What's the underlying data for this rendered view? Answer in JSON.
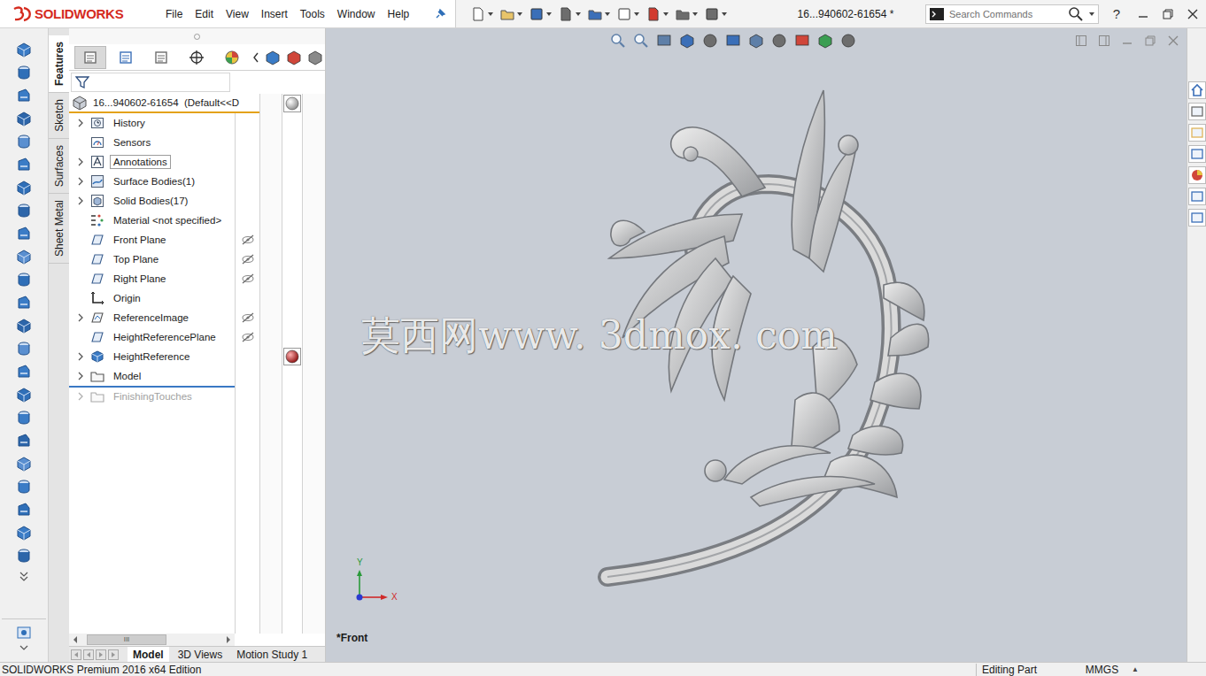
{
  "app": {
    "brand": "SOLIDWORKS"
  },
  "menu": [
    "File",
    "Edit",
    "View",
    "Insert",
    "Tools",
    "Window",
    "Help"
  ],
  "document": {
    "title": "16...940602-61654 *"
  },
  "search": {
    "placeholder": "Search Commands"
  },
  "help": {
    "label": "?"
  },
  "feature_tabs": [
    {
      "label": "Features",
      "selected": true
    },
    {
      "label": "Sketch",
      "selected": false
    },
    {
      "label": "Surfaces",
      "selected": false
    },
    {
      "label": "Sheet Metal",
      "selected": false
    }
  ],
  "tree": {
    "root": {
      "label": "16...940602-61654  (Default<<D",
      "appearance": "#8c8c8c"
    },
    "items": [
      {
        "label": "History",
        "kind": "history",
        "expandable": true,
        "selected": false,
        "hidden": false,
        "rolled_back": false,
        "appearance": null
      },
      {
        "label": "Sensors",
        "kind": "sensor",
        "expandable": false,
        "selected": false,
        "hidden": false,
        "rolled_back": false,
        "appearance": null
      },
      {
        "label": "Annotations",
        "kind": "annotation",
        "expandable": true,
        "selected": true,
        "hidden": false,
        "rolled_back": false,
        "appearance": null
      },
      {
        "label": "Surface Bodies(1)",
        "kind": "surface",
        "expandable": true,
        "selected": false,
        "hidden": false,
        "rolled_back": false,
        "appearance": null
      },
      {
        "label": "Solid Bodies(17)",
        "kind": "solid",
        "expandable": true,
        "selected": false,
        "hidden": false,
        "rolled_back": false,
        "appearance": null
      },
      {
        "label": "Material <not specified>",
        "kind": "material",
        "expandable": false,
        "selected": false,
        "hidden": false,
        "rolled_back": false,
        "appearance": null
      },
      {
        "label": "Front Plane",
        "kind": "plane",
        "expandable": false,
        "selected": false,
        "hidden": true,
        "rolled_back": false,
        "appearance": null
      },
      {
        "label": "Top Plane",
        "kind": "plane",
        "expandable": false,
        "selected": false,
        "hidden": true,
        "rolled_back": false,
        "appearance": null
      },
      {
        "label": "Right Plane",
        "kind": "plane",
        "expandable": false,
        "selected": false,
        "hidden": true,
        "rolled_back": false,
        "appearance": null
      },
      {
        "label": "Origin",
        "kind": "origin",
        "expandable": false,
        "selected": false,
        "hidden": false,
        "rolled_back": false,
        "appearance": null
      },
      {
        "label": "ReferenceImage",
        "kind": "sketch",
        "expandable": true,
        "selected": false,
        "hidden": true,
        "rolled_back": false,
        "appearance": null
      },
      {
        "label": "HeightReferencePlane",
        "kind": "plane",
        "expandable": false,
        "selected": false,
        "hidden": true,
        "rolled_back": false,
        "appearance": null
      },
      {
        "label": "HeightReference",
        "kind": "feature",
        "expandable": true,
        "selected": false,
        "hidden": false,
        "rolled_back": false,
        "appearance": "#8b0d0d"
      },
      {
        "label": "Model",
        "kind": "folder",
        "expandable": true,
        "selected": false,
        "hidden": false,
        "rolled_back": false,
        "appearance": null
      },
      {
        "label": "FinishingTouches",
        "kind": "folder",
        "expandable": true,
        "selected": false,
        "hidden": false,
        "rolled_back": true,
        "appearance": null
      }
    ],
    "scroll_grip": "III"
  },
  "document_tabs": [
    {
      "label": "Model",
      "selected": true
    },
    {
      "label": "3D Views",
      "selected": false
    },
    {
      "label": "Motion Study 1",
      "selected": false
    }
  ],
  "viewport": {
    "view_label": "*Front",
    "watermark": "莫西网www. 3dmox. com",
    "triad": {
      "y_label": "Y",
      "x_label": "X"
    }
  },
  "status_bar": {
    "product": "SOLIDWORKS Premium 2016 x64 Edition",
    "mode": "Editing Part",
    "units": "MMGS",
    "units_toggle": "▲"
  }
}
